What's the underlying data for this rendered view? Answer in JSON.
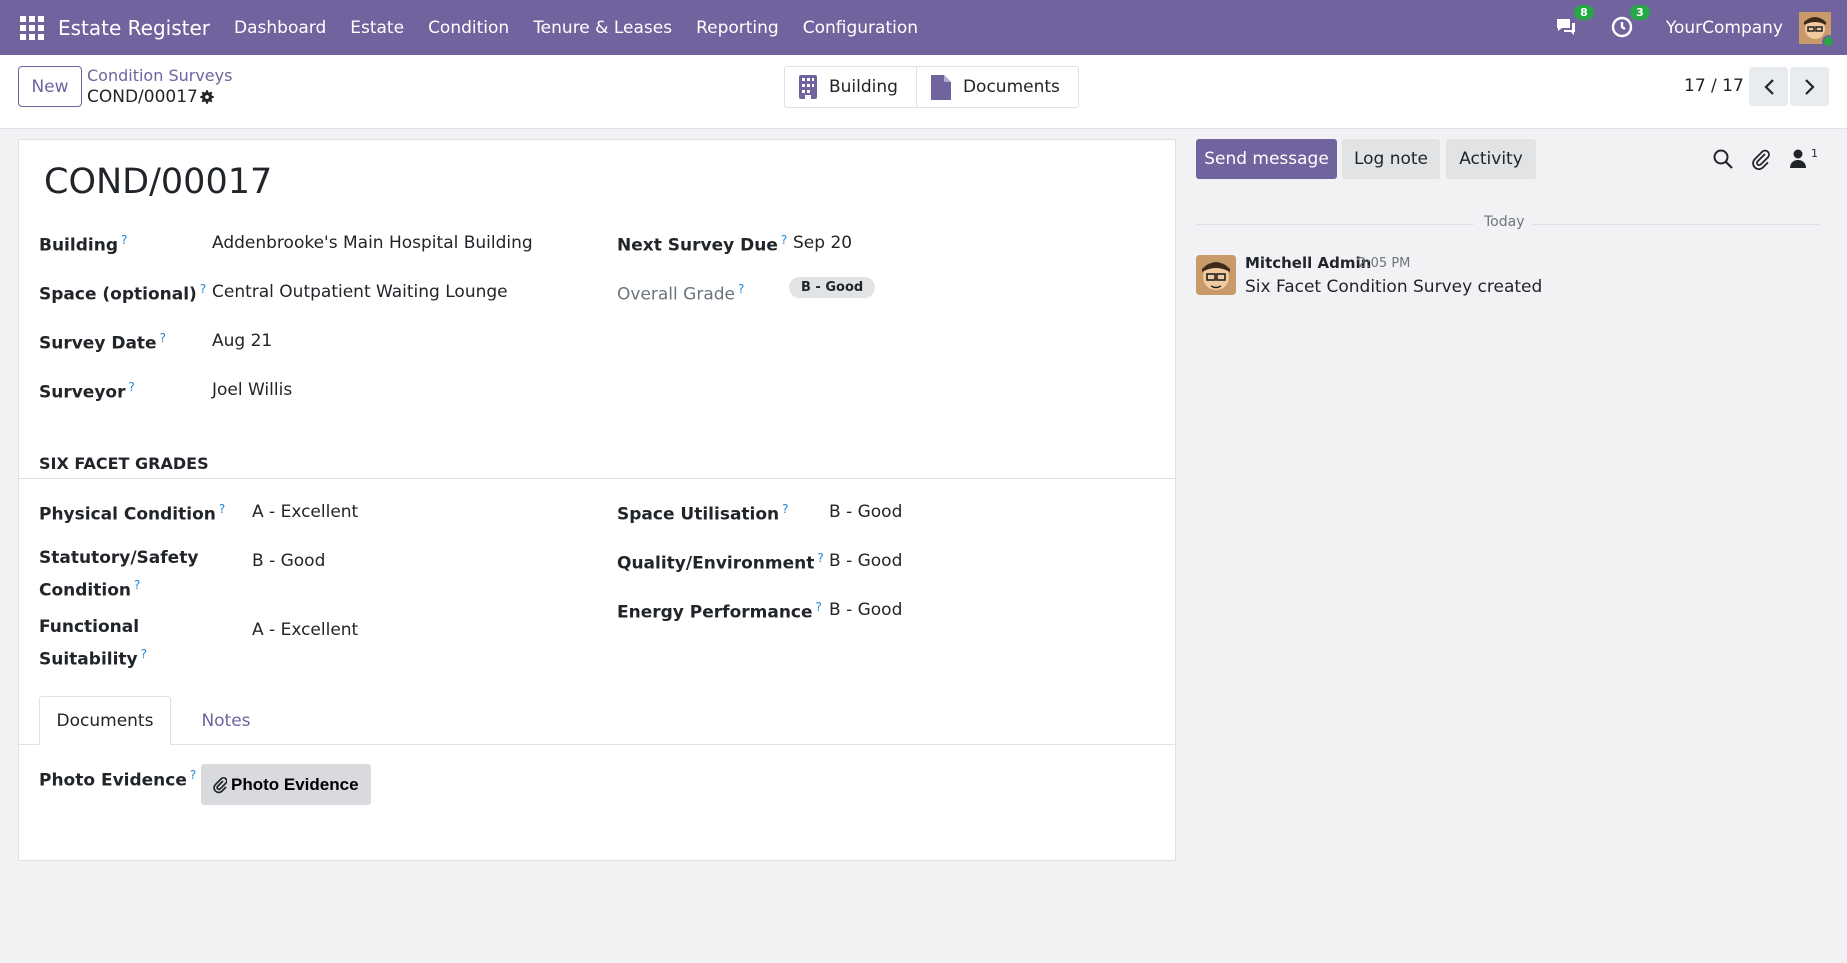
{
  "navbar": {
    "brand": "Estate Register",
    "menu": [
      "Dashboard",
      "Estate",
      "Condition",
      "Tenure & Leases",
      "Reporting",
      "Configuration"
    ],
    "messages_badge": "8",
    "activities_badge": "3",
    "company": "YourCompany",
    "color": "#71639e"
  },
  "control": {
    "new_label": "New",
    "breadcrumb_parent": "Condition Surveys",
    "record_name": "COND/00017",
    "smart_buttons": [
      "Building",
      "Documents"
    ],
    "pager": "17 / 17"
  },
  "form": {
    "title": "COND/00017",
    "fields": {
      "building": {
        "label": "Building",
        "value": "Addenbrooke's Main Hospital Building"
      },
      "space": {
        "label": "Space (optional)",
        "value": "Central Outpatient Waiting Lounge"
      },
      "survey_date": {
        "label": "Survey Date",
        "value": "Aug 21"
      },
      "surveyor": {
        "label": "Surveyor",
        "value": "Joel Willis"
      },
      "next_survey_due": {
        "label": "Next Survey Due",
        "value": "Sep 20"
      },
      "overall_grade": {
        "label": "Overall Grade",
        "value": "B - Good"
      }
    },
    "help_mark": "?",
    "section_title": "SIX FACET GRADES",
    "grades": {
      "physical": {
        "label": "Physical Condition",
        "value": "A - Excellent"
      },
      "statutory": {
        "label_line1": "Statutory/Safety",
        "label_line2": "Condition",
        "value": "B - Good"
      },
      "functional": {
        "label_line1": "Functional",
        "label_line2": "Suitability",
        "value": "A - Excellent"
      },
      "space_util": {
        "label": "Space Utilisation",
        "value": "B - Good"
      },
      "quality": {
        "label": "Quality/Environment",
        "value": "B - Good"
      },
      "energy": {
        "label": "Energy Performance",
        "value": "B - Good"
      }
    },
    "tabs": [
      "Documents",
      "Notes"
    ],
    "photo_evidence": {
      "label": "Photo Evidence",
      "button": "Photo Evidence"
    }
  },
  "chatter": {
    "send_message": "Send message",
    "log_note": "Log note",
    "activity": "Activity",
    "followers_count": "1",
    "date_separator": "Today",
    "message": {
      "author": "Mitchell Admin",
      "time": "2:05 PM",
      "body": "Six Facet Condition Survey created"
    }
  }
}
